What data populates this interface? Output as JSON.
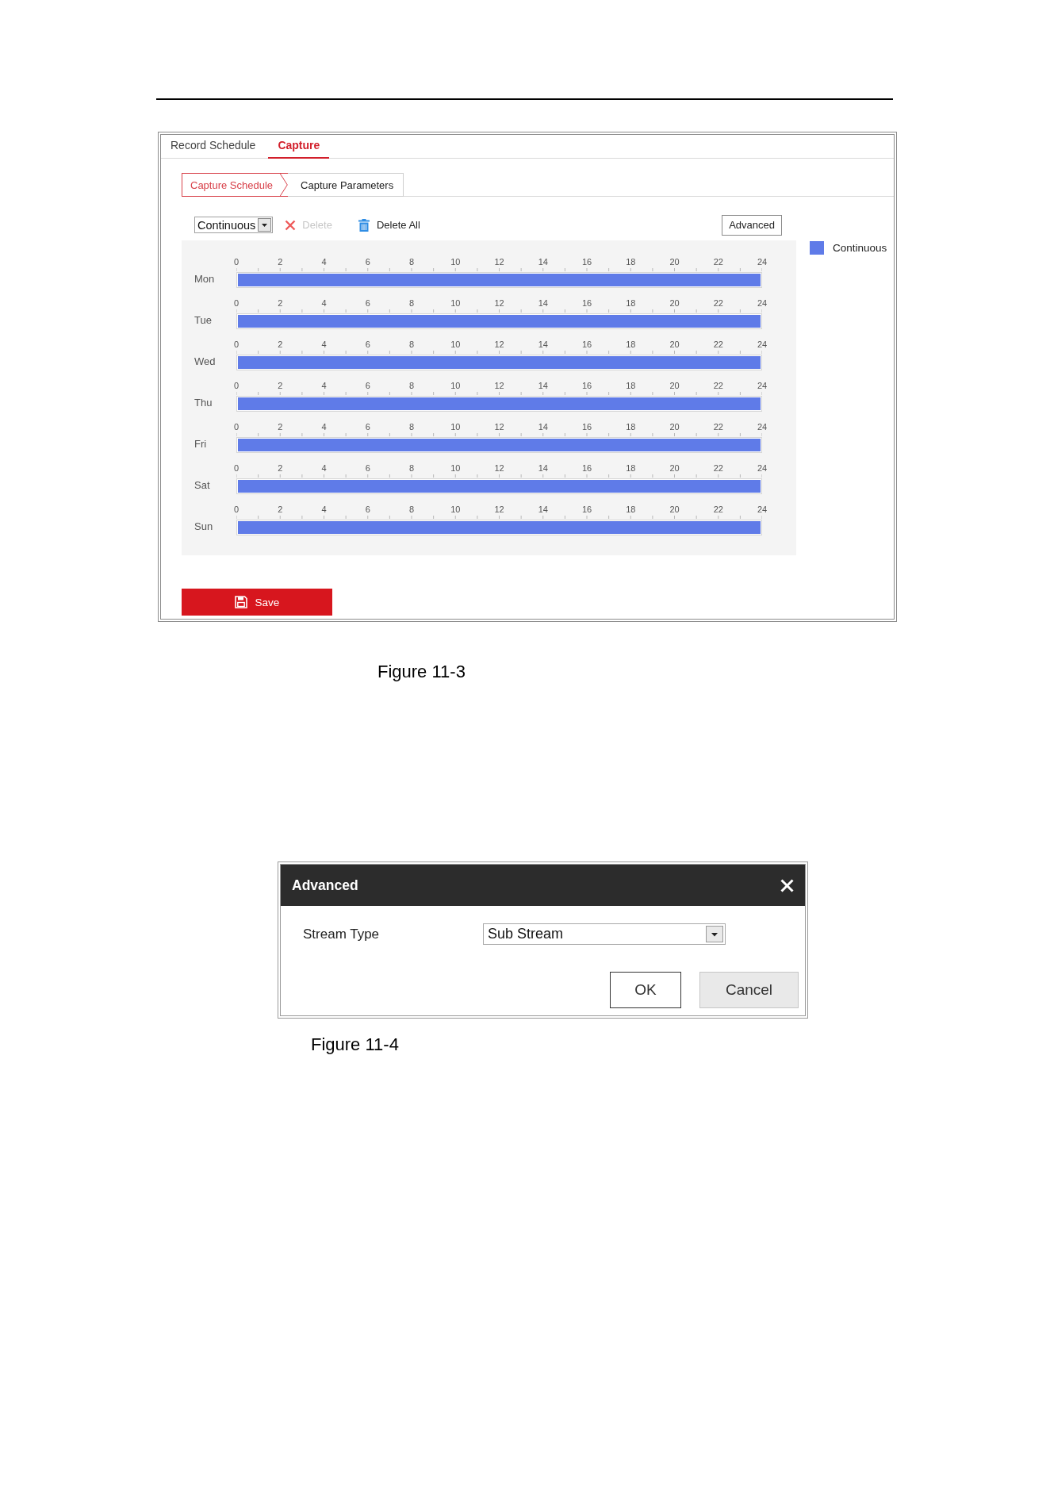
{
  "figures": [
    {
      "kind": "schedule",
      "tabs": [
        {
          "label": "Record Schedule",
          "selected": false
        },
        {
          "label": "Capture",
          "selected": true
        }
      ],
      "subtabs": [
        {
          "label": "Capture Schedule",
          "selected": true
        },
        {
          "label": "Capture Parameters",
          "selected": false
        }
      ],
      "toolbar": {
        "schedule_type": {
          "value": "Continuous"
        },
        "delete": {
          "label": "Delete",
          "disabled": true
        },
        "delete_all": {
          "label": "Delete All",
          "disabled": false
        },
        "advanced": {
          "label": "Advanced"
        }
      },
      "days": [
        {
          "label": "Mon",
          "hours": [
            "0",
            "2",
            "4",
            "6",
            "8",
            "10",
            "12",
            "14",
            "16",
            "18",
            "20",
            "22",
            "24"
          ],
          "level": 1
        },
        {
          "label": "Tue",
          "hours": [
            "0",
            "2",
            "4",
            "6",
            "8",
            "10",
            "12",
            "14",
            "16",
            "18",
            "20",
            "22",
            "24"
          ],
          "level": 1
        },
        {
          "label": "Wed",
          "hours": [
            "0",
            "2",
            "4",
            "6",
            "8",
            "10",
            "12",
            "14",
            "16",
            "18",
            "20",
            "22",
            "24"
          ],
          "level": 1
        },
        {
          "label": "Thu",
          "hours": [
            "0",
            "2",
            "4",
            "6",
            "8",
            "10",
            "12",
            "14",
            "16",
            "18",
            "20",
            "22",
            "24"
          ],
          "level": 1
        },
        {
          "label": "Fri",
          "hours": [
            "0",
            "2",
            "4",
            "6",
            "8",
            "10",
            "12",
            "14",
            "16",
            "18",
            "20",
            "22",
            "24"
          ],
          "level": 1
        },
        {
          "label": "Sat",
          "hours": [
            "0",
            "2",
            "4",
            "6",
            "8",
            "10",
            "12",
            "14",
            "16",
            "18",
            "20",
            "22",
            "24"
          ],
          "level": 1
        },
        {
          "label": "Sun",
          "hours": [
            "0",
            "2",
            "4",
            "6",
            "8",
            "10",
            "12",
            "14",
            "16",
            "18",
            "20",
            "22",
            "24"
          ],
          "level": 1
        }
      ],
      "legend": [
        {
          "label": "Continuous",
          "color": "#5f7be8"
        }
      ],
      "save": {
        "label": "Save"
      },
      "caption": "Figure 11-3"
    },
    {
      "kind": "dialog",
      "title": "Advanced",
      "fields": [
        {
          "label": "Stream Type",
          "value": "Sub Stream"
        }
      ],
      "buttons": [
        {
          "label": "OK",
          "kind": "primary"
        },
        {
          "label": "Cancel",
          "kind": "secondary"
        }
      ],
      "caption": "Figure 11-4"
    }
  ]
}
